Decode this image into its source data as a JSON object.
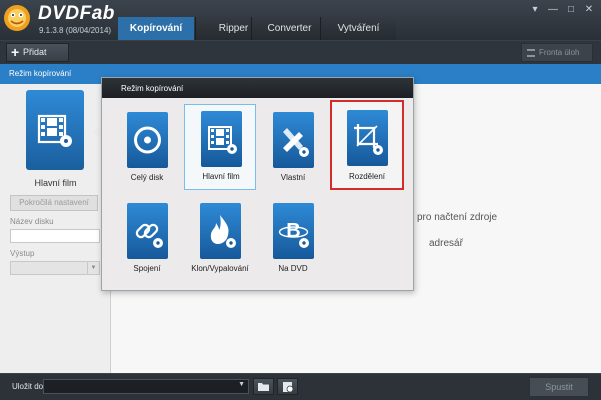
{
  "app": {
    "brand": "DVDFab",
    "version": "9.1.3.8 (08/04/2014)"
  },
  "tabs": [
    {
      "label": "Kopírování",
      "active": true
    },
    {
      "label": "Ripper",
      "active": false
    },
    {
      "label": "Converter",
      "active": false
    },
    {
      "label": "Vytváření",
      "active": false
    }
  ],
  "window_controls": {
    "menu": "▾",
    "minimize": "—",
    "maximize": "□",
    "close": "✕"
  },
  "toolbar": {
    "add_label": "Přidat",
    "queue_label": "Fronta úloh"
  },
  "bluebar": {
    "label": "Režim kopírování"
  },
  "sidebar": {
    "current_mode": "Hlavní film",
    "advanced_button": "Pokročilá nastavení",
    "disc_name_label": "Název disku",
    "disc_name_value": "",
    "output_label": "Výstup",
    "output_value": ""
  },
  "main": {
    "hint_1": "pro načtení zdroje",
    "hint_2": "adresář"
  },
  "popup": {
    "title": "Režim kopírování",
    "modes": [
      {
        "label": "Celý disk",
        "icon": "disc-icon"
      },
      {
        "label": "Hlavní film",
        "icon": "film-icon",
        "state": "current"
      },
      {
        "label": "Vlastní",
        "icon": "customize-icon"
      },
      {
        "label": "Rozdělení",
        "icon": "split-icon",
        "state": "highlighted"
      },
      {
        "label": "Spojení",
        "icon": "link-icon"
      },
      {
        "label": "Klon/Vypalování",
        "icon": "burn-icon"
      },
      {
        "label": "Na DVD",
        "icon": "bluray-to-dvd-icon"
      }
    ]
  },
  "bottombar": {
    "save_label": "Uložit do:",
    "save_value": "",
    "start_label": "Spustit"
  },
  "colors": {
    "accent": "#2b7fc6",
    "highlight": "#d42b2b",
    "dark": "#2c3238"
  }
}
